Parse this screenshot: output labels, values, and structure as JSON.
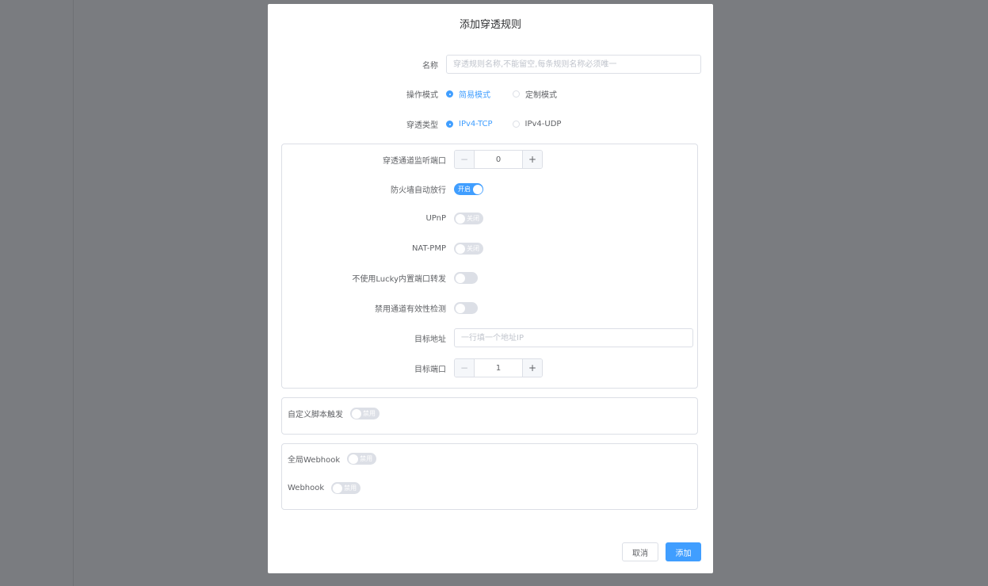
{
  "dialog": {
    "title": "添加穿透规则",
    "name_field": {
      "label": "名称",
      "value": "",
      "placeholder": "穿透规则名称,不能留空,每条规则名称必须唯一"
    },
    "mode": {
      "label": "操作模式",
      "options": [
        "简易模式",
        "定制模式"
      ],
      "selected": "简易模式"
    },
    "type": {
      "label": "穿透类型",
      "options": [
        "IPv4-TCP",
        "IPv4-UDP"
      ],
      "selected": "IPv4-TCP"
    },
    "main_panel": {
      "listen_port": {
        "label": "穿透通道监听端口",
        "value": "0",
        "minus": "−",
        "plus": "+"
      },
      "firewall": {
        "label": "防火墙自动放行",
        "state": true,
        "text": "开启"
      },
      "upnp": {
        "label": "UPnP",
        "state": false,
        "text": "关闭"
      },
      "natpmp": {
        "label": "NAT-PMP",
        "state": false,
        "text": "关闭"
      },
      "no_builtin_forward": {
        "label": "不使用Lucky内置端口转发",
        "state": false
      },
      "disable_check": {
        "label": "禁用通道有效性检测",
        "state": false
      },
      "target_addr": {
        "label": "目标地址",
        "value": "",
        "placeholder": "一行填一个地址IP"
      },
      "target_port": {
        "label": "目标端口",
        "value": "1",
        "minus": "−",
        "plus": "+"
      }
    },
    "script_panel": {
      "label": "自定义脚本触发",
      "state": false,
      "text": "禁用"
    },
    "webhook_panel": {
      "global_webhook": {
        "label": "全局Webhook",
        "state": false,
        "text": "禁用"
      },
      "webhook": {
        "label": "Webhook",
        "state": false,
        "text": "禁用"
      }
    },
    "footer": {
      "cancel": "取消",
      "submit": "添加"
    }
  },
  "colors": {
    "accent": "#409eff",
    "overlay": "#7a7c80",
    "border": "#dcdfe6"
  }
}
